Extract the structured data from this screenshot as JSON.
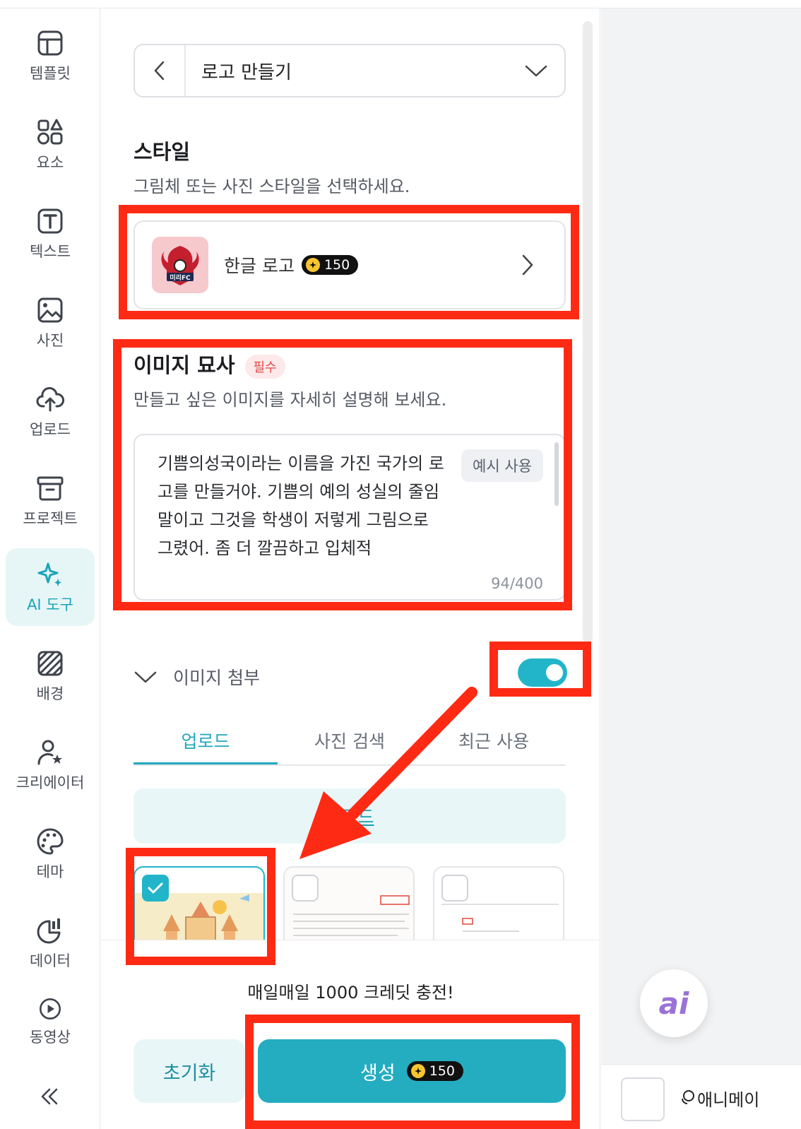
{
  "rail": {
    "items": [
      {
        "label": "템플릿",
        "icon": "template-icon"
      },
      {
        "label": "요소",
        "icon": "elements-icon"
      },
      {
        "label": "텍스트",
        "icon": "text-icon"
      },
      {
        "label": "사진",
        "icon": "photo-icon"
      },
      {
        "label": "업로드",
        "icon": "upload-cloud-icon"
      },
      {
        "label": "프로젝트",
        "icon": "project-box-icon"
      },
      {
        "label": "AI 도구",
        "icon": "ai-sparkle-icon",
        "active": true
      },
      {
        "label": "배경",
        "icon": "background-pattern-icon"
      },
      {
        "label": "크리에이터",
        "icon": "creator-icon"
      },
      {
        "label": "테마",
        "icon": "palette-icon"
      },
      {
        "label": "데이터",
        "icon": "chart-icon"
      },
      {
        "label": "동영상",
        "icon": "play-icon"
      }
    ]
  },
  "panel": {
    "selector_title": "로고 만들기",
    "style_section": {
      "title": "스타일",
      "subtitle": "그림체 또는 사진 스타일을 선택하세요.",
      "selected_style": "한글 로고",
      "credit": "150",
      "thumb_text": "미리FC"
    },
    "desc_section": {
      "title": "이미지 묘사",
      "required_badge": "필수",
      "subtitle": "만들고 싶은 이미지를 자세히 설명해 보세요.",
      "text": "기쁨의성국이라는 이름을 가진 국가의 로고를 만들거야. 기쁨의 예의 성실의 줄임말이고 그것을 학생이 저렇게 그림으로 그렸어. 좀 더 깔끔하고 입체적",
      "example_button": "예시 사용",
      "counter": "94/400"
    },
    "attach": {
      "label": "이미지 첨부",
      "toggle_on": true
    },
    "tabs": [
      "업로드",
      "사진 검색",
      "최근 사용"
    ],
    "upload_button": "업로드",
    "promo": "매일매일 1000 크레딧 충전!",
    "reset_button": "초기화",
    "generate_button": "생성",
    "generate_credit": "150"
  },
  "canvas": {
    "bottom_label": "애니메이"
  },
  "colors": {
    "accent": "#22b5c9",
    "annotation": "#ff2a14"
  }
}
